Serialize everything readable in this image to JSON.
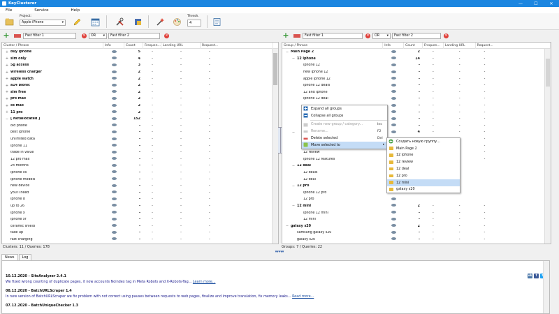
{
  "app": {
    "title": "KeyClusterer"
  },
  "window": {
    "minimize": "—",
    "maximize": "☐",
    "close": "✕"
  },
  "menu": [
    "File",
    "Service",
    "Help"
  ],
  "toolbar": {
    "project_label": "Project:",
    "project_value": "Apple iPhone",
    "threshold_label": "Thresh.",
    "threshold_value": "4"
  },
  "left_filter": {
    "filter1_placeholder": "Fast filter 1",
    "operator": "OR",
    "filter2_placeholder": "Fast filter 2"
  },
  "right_filter": {
    "filter1_placeholder": "Fast filter 1",
    "operator": "OR",
    "filter2_placeholder": "Fast filter 2"
  },
  "left_grid": {
    "columns": [
      "Cluster / Phrase",
      "Info",
      "Count",
      "Frequen...",
      "Landing URL",
      "Request..."
    ],
    "rows": [
      {
        "exp": "+",
        "phrase": "buy iphone",
        "bold": true,
        "count": "5",
        "freq": "-",
        "url": "-",
        "req": "-"
      },
      {
        "exp": "+",
        "phrase": "sim only",
        "bold": true,
        "count": "4",
        "freq": "-",
        "url": "-",
        "req": "-"
      },
      {
        "exp": "+",
        "phrase": "5g access",
        "bold": true,
        "count": "3",
        "freq": "-",
        "url": "-",
        "req": "-"
      },
      {
        "exp": "+",
        "phrase": "wireless charger",
        "bold": true,
        "count": "2",
        "freq": "-",
        "url": "-",
        "req": "-"
      },
      {
        "exp": "+",
        "phrase": "apple watch",
        "bold": true,
        "count": "2",
        "freq": "-",
        "url": "-",
        "req": "-"
      },
      {
        "exp": "+",
        "phrase": "a14 bionic",
        "bold": true,
        "count": "2",
        "freq": "-",
        "url": "-",
        "req": "-"
      },
      {
        "exp": "+",
        "phrase": "sim free",
        "bold": true,
        "count": "2",
        "freq": "-",
        "url": "-",
        "req": "-"
      },
      {
        "exp": "+",
        "phrase": "pro max",
        "bold": true,
        "count": "2",
        "freq": "-",
        "url": "-",
        "req": "-"
      },
      {
        "exp": "+",
        "phrase": "xs max",
        "bold": true,
        "count": "2",
        "freq": "-",
        "url": "-",
        "req": "-"
      },
      {
        "exp": "+",
        "phrase": "11 pro",
        "bold": true,
        "count": "2",
        "freq": "-",
        "url": "-",
        "req": "-"
      },
      {
        "exp": "−",
        "phrase": "[ Notallocated ]",
        "bold": true,
        "count": "152",
        "freq": "-",
        "url": "-",
        "req": "-"
      },
      {
        "exp": "",
        "phrase": "old phone",
        "bold": false,
        "count": "-",
        "freq": "-",
        "url": "-",
        "req": "-"
      },
      {
        "exp": "",
        "phrase": "best iphone",
        "bold": false,
        "count": "-",
        "freq": "-",
        "url": "-",
        "req": "-"
      },
      {
        "exp": "",
        "phrase": "unlimited data",
        "bold": false,
        "count": "-",
        "freq": "-",
        "url": "-",
        "req": "-"
      },
      {
        "exp": "",
        "phrase": "iphone 11",
        "bold": false,
        "count": "-",
        "freq": "-",
        "url": "-",
        "req": "-"
      },
      {
        "exp": "",
        "phrase": "trade in value",
        "bold": false,
        "count": "-",
        "freq": "-",
        "url": "-",
        "req": "-"
      },
      {
        "exp": "",
        "phrase": "12 pro max",
        "bold": false,
        "count": "-",
        "freq": "-",
        "url": "-",
        "req": "-"
      },
      {
        "exp": "",
        "phrase": "24 months",
        "bold": false,
        "count": "-",
        "freq": "-",
        "url": "-",
        "req": "-"
      },
      {
        "exp": "",
        "phrase": "iphone xs",
        "bold": false,
        "count": "-",
        "freq": "-",
        "url": "-",
        "req": "-"
      },
      {
        "exp": "",
        "phrase": "iphone models",
        "bold": false,
        "count": "-",
        "freq": "-",
        "url": "-",
        "req": "-"
      },
      {
        "exp": "",
        "phrase": "new device",
        "bold": false,
        "count": "-",
        "freq": "-",
        "url": "-",
        "req": "-"
      },
      {
        "exp": "",
        "phrase": "you'll need",
        "bold": false,
        "count": "-",
        "freq": "-",
        "url": "-",
        "req": "-"
      },
      {
        "exp": "",
        "phrase": "iphone 8",
        "bold": false,
        "count": "-",
        "freq": "-",
        "url": "-",
        "req": "-"
      },
      {
        "exp": "",
        "phrase": "up to 26",
        "bold": false,
        "count": "-",
        "freq": "-",
        "url": "-",
        "req": "-"
      },
      {
        "exp": "",
        "phrase": "iphone x",
        "bold": false,
        "count": "-",
        "freq": "-",
        "url": "-",
        "req": "-"
      },
      {
        "exp": "",
        "phrase": "iphone xr",
        "bold": false,
        "count": "-",
        "freq": "-",
        "url": "-",
        "req": "-"
      },
      {
        "exp": "",
        "phrase": "ceramic shield",
        "bold": false,
        "count": "-",
        "freq": "-",
        "url": "-",
        "req": "-"
      },
      {
        "exp": "",
        "phrase": "take up",
        "bold": false,
        "count": "-",
        "freq": "-",
        "url": "-",
        "req": "-"
      },
      {
        "exp": "",
        "phrase": "fast charging",
        "bold": false,
        "count": "-",
        "freq": "-",
        "url": "-",
        "req": "-"
      }
    ],
    "status": "Clusters: 11 / Queries: 178"
  },
  "right_grid": {
    "columns": [
      "Group / Phrase",
      "Info",
      "Count",
      "Frequen...",
      "Landing URL",
      "Request..."
    ],
    "rows": [
      {
        "exp": "−",
        "indent": 0,
        "phrase": "Main Page 2",
        "bold": true,
        "count": "2",
        "freq": "-",
        "url": "-",
        "req": "-"
      },
      {
        "exp": "−",
        "indent": 1,
        "phrase": "12 iphone",
        "bold": true,
        "count": "14",
        "freq": "-",
        "url": "-",
        "req": "-"
      },
      {
        "exp": "",
        "indent": 2,
        "phrase": "iphone 12",
        "bold": false,
        "count": "-",
        "freq": "-",
        "url": "-",
        "req": "-"
      },
      {
        "exp": "",
        "indent": 2,
        "phrase": "new iphone 12",
        "bold": false,
        "count": "-",
        "freq": "-",
        "url": "-",
        "req": "-"
      },
      {
        "exp": "",
        "indent": 2,
        "phrase": "apple iphone 12",
        "bold": false,
        "count": "-",
        "freq": "-",
        "url": "-",
        "req": "-"
      },
      {
        "exp": "",
        "indent": 2,
        "phrase": "iphone 12 deals",
        "bold": false,
        "count": "-",
        "freq": "-",
        "url": "-",
        "req": "-"
      },
      {
        "exp": "",
        "indent": 2,
        "phrase": "12 and iphone",
        "bold": false,
        "count": "-",
        "freq": "-",
        "url": "-",
        "req": "-"
      },
      {
        "exp": "",
        "indent": 2,
        "phrase": "iphone 12 deal",
        "bold": false,
        "count": "-",
        "freq": "-",
        "url": "-",
        "req": "-"
      },
      {
        "exp": "",
        "indent": 2,
        "phrase": "",
        "bold": false,
        "count": "-",
        "freq": "-",
        "url": "-",
        "req": "-"
      },
      {
        "exp": "",
        "indent": 2,
        "phrase": "",
        "bold": false,
        "count": "-",
        "freq": "-",
        "url": "-",
        "req": "-"
      },
      {
        "exp": "",
        "indent": 2,
        "phrase": "",
        "bold": false,
        "count": "-",
        "freq": "-",
        "url": "-",
        "req": "-"
      },
      {
        "exp": "",
        "indent": 2,
        "phrase": "",
        "bold": false,
        "count": "-",
        "freq": "-",
        "url": "-",
        "req": "-"
      },
      {
        "exp": "−",
        "indent": 1,
        "phrase": "",
        "bold": true,
        "count": "4",
        "freq": "-",
        "url": "-",
        "req": "-"
      },
      {
        "exp": "",
        "indent": 2,
        "phrase": "",
        "bold": false,
        "count": "-",
        "freq": "-",
        "url": "-",
        "req": "-"
      },
      {
        "exp": "",
        "indent": 2,
        "phrase": "iphone 12 range",
        "bold": false,
        "count": "-",
        "freq": "-",
        "url": "-",
        "req": "-"
      },
      {
        "exp": "",
        "indent": 2,
        "phrase": "12 review",
        "bold": false,
        "count": "-",
        "freq": "-",
        "url": "-",
        "req": "-"
      },
      {
        "exp": "",
        "indent": 2,
        "phrase": "iphone 12 features",
        "bold": false,
        "count": "-",
        "freq": "-",
        "url": "-",
        "req": "-"
      },
      {
        "exp": "−",
        "indent": 1,
        "phrase": "12 deal",
        "bold": true,
        "count": "",
        "freq": "",
        "url": "",
        "req": ""
      },
      {
        "exp": "",
        "indent": 2,
        "phrase": "12 deals",
        "bold": false,
        "count": "",
        "freq": "",
        "url": "",
        "req": ""
      },
      {
        "exp": "",
        "indent": 2,
        "phrase": "12 deal",
        "bold": false,
        "count": "",
        "freq": "",
        "url": "",
        "req": ""
      },
      {
        "exp": "−",
        "indent": 1,
        "phrase": "12 pro",
        "bold": true,
        "count": "",
        "freq": "",
        "url": "",
        "req": ""
      },
      {
        "exp": "",
        "indent": 2,
        "phrase": "iphone 12 pro",
        "bold": false,
        "count": "",
        "freq": "",
        "url": "",
        "req": ""
      },
      {
        "exp": "",
        "indent": 2,
        "phrase": "12 pro",
        "bold": false,
        "count": "",
        "freq": "",
        "url": "",
        "req": ""
      },
      {
        "exp": "−",
        "indent": 1,
        "phrase": "12 mini",
        "bold": true,
        "count": "2",
        "freq": "-",
        "url": "-",
        "req": "-"
      },
      {
        "exp": "",
        "indent": 2,
        "phrase": "iphone 12 mini",
        "bold": false,
        "count": "-",
        "freq": "-",
        "url": "-",
        "req": "-"
      },
      {
        "exp": "",
        "indent": 2,
        "phrase": "12 mini",
        "bold": false,
        "count": "-",
        "freq": "-",
        "url": "-",
        "req": "-"
      },
      {
        "exp": "−",
        "indent": 0,
        "phrase": "galaxy s20",
        "bold": true,
        "count": "2",
        "freq": "-",
        "url": "-",
        "req": "-"
      },
      {
        "exp": "",
        "indent": 1,
        "phrase": "samsung galaxy s20",
        "bold": false,
        "count": "-",
        "freq": "-",
        "url": "-",
        "req": "-"
      },
      {
        "exp": "",
        "indent": 1,
        "phrase": "galaxy s20",
        "bold": false,
        "count": "-",
        "freq": "-",
        "url": "-",
        "req": "-"
      }
    ],
    "status": "Groups: 7 / Queries: 22"
  },
  "context_menu": {
    "items": [
      {
        "label": "Expand all groups",
        "key": "",
        "disabled": false,
        "icon": "expand-icon"
      },
      {
        "label": "Collapse all groups",
        "key": "",
        "disabled": false,
        "icon": "collapse-icon"
      },
      {
        "sep": true
      },
      {
        "label": "Create new group / category...",
        "key": "Ins",
        "disabled": true,
        "icon": "new-group-icon"
      },
      {
        "label": "Rename...",
        "key": "F2",
        "disabled": true,
        "icon": "rename-icon"
      },
      {
        "label": "Delete selected",
        "key": "Del",
        "disabled": false,
        "icon": "delete-icon"
      },
      {
        "label": "Move selected to",
        "key": "",
        "disabled": false,
        "icon": "move-icon",
        "highlight": true,
        "arrow": "▸"
      }
    ]
  },
  "submenu": {
    "items": [
      {
        "label": "Создать новую группу...",
        "icon": "plus-icon"
      },
      {
        "label": "Main Page 2",
        "icon": "folder-icon"
      },
      {
        "label": "12 iphone",
        "icon": "folder-icon"
      },
      {
        "label": "12 review",
        "icon": "folder-icon"
      },
      {
        "label": "12 deal",
        "icon": "folder-icon"
      },
      {
        "label": "12 pro",
        "icon": "folder-icon"
      },
      {
        "label": "12 mini",
        "icon": "folder-icon",
        "highlight": true
      },
      {
        "label": "galaxy s20",
        "icon": "folder-icon"
      }
    ]
  },
  "bottom_tabs": [
    "News",
    "Log"
  ],
  "news": [
    {
      "date_title": "10.12.2020 - SiteAnalyzer 2.4.1",
      "text": "We fixed wrong counting of duplicate pages, it now accounts Noindex tag in Meta Robots and X-Robots-Tag...",
      "more": "Learn more..."
    },
    {
      "date_title": "08.12.2020 - BatchURLScraper 1.4",
      "text": "In new version of BatchURLScraper we fix problem with not correct using pauses between requests to web pages, finalize and improve translation, fix memory leaks...",
      "more": "Read more..."
    },
    {
      "date_title": "07.12.2020 - BatchUniqueChecker 1.3",
      "text": "",
      "more": ""
    }
  ],
  "social": [
    "vk",
    "f",
    "t"
  ],
  "colors": {
    "titlebar": "#1c86e0",
    "highlight": "#c4dcf6",
    "folder": "#e7b93a"
  }
}
